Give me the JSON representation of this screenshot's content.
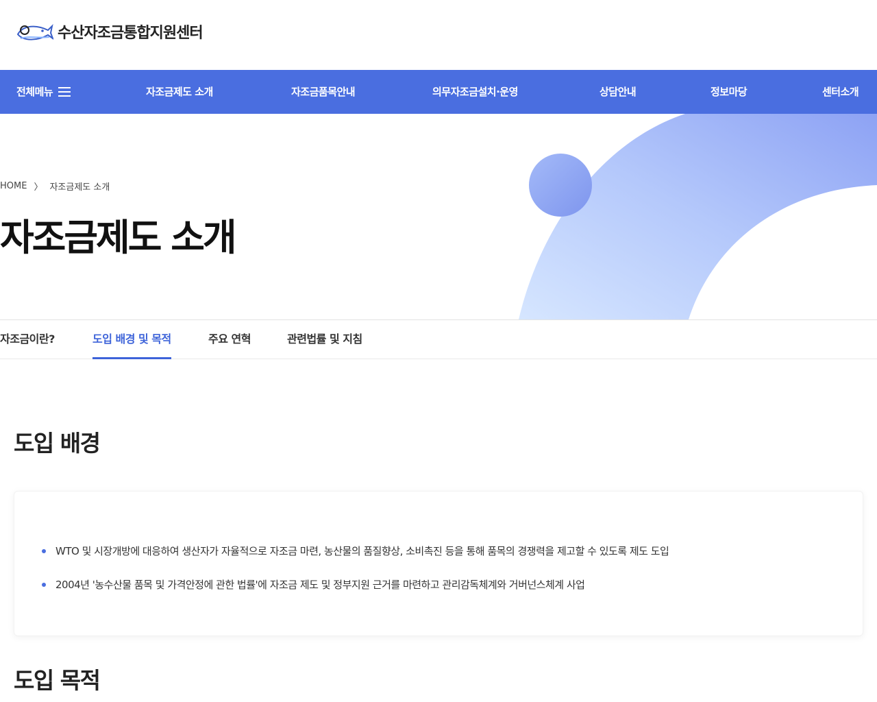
{
  "site": {
    "name": "수산자조금통합지원센터"
  },
  "nav": {
    "all_menu": "전체메뉴",
    "items": [
      "자조금제도 소개",
      "자조금품목안내",
      "의무자조금설치·운영",
      "상담안내",
      "정보마당",
      "센터소개"
    ]
  },
  "breadcrumb": {
    "home": "HOME",
    "current": "자조금제도 소개"
  },
  "page": {
    "title": "자조금제도 소개"
  },
  "tabs": [
    "자조금이란?",
    "도입 배경 및 목적",
    "주요 연혁",
    "관련법률 및 지침"
  ],
  "active_tab": "도입 배경 및 목적",
  "sections": {
    "background": {
      "title": "도입 배경",
      "items": [
        "WTO 및 시장개방에 대응하여 생산자가 자율적으로 자조금 마련, 농산물의 품질향상, 소비촉진 등을 통해 품목의 경쟁력을 제고할 수 있도록 제도 도입",
        "2004년 '농수산물 품목 및 가격안정에 관한 법률'에 자조금 제도 및 정부지원 근거를 마련하고 관리감독체계와 거버넌스체계 사업"
      ]
    },
    "purpose": {
      "title": "도입 목적"
    }
  },
  "colors": {
    "primary": "#4a6ee0",
    "active_tab": "#3d63d9"
  },
  "icons": {
    "logo": "fish-logo-icon",
    "menu": "hamburger-icon",
    "breadcrumb_sep": "chevron-right-icon"
  }
}
